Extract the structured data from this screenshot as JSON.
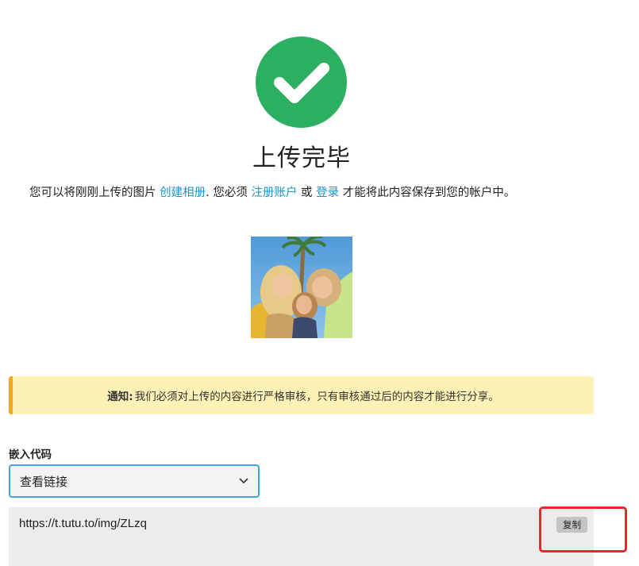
{
  "page": {
    "title": "上传完毕",
    "desc_prefix": "您可以将刚刚上传的图片 ",
    "link_create_album": "创建相册",
    "desc_mid1": ". 您必须 ",
    "link_register": "注册账户",
    "desc_mid2": " 或 ",
    "link_login": "登录",
    "desc_suffix": " 才能将此内容保存到您的帐户中。"
  },
  "notice": {
    "label": "通知:",
    "text": "我们必须对上传的内容进行严格审核，只有审核通过后的内容才能进行分享。"
  },
  "embed": {
    "label": "嵌入代码",
    "selected": "查看链接",
    "code": "https://t.tutu.to/img/ZLzq",
    "copy_label": "复制"
  },
  "icons": {
    "success": "check-circle-icon",
    "dropdown": "chevron-down-icon"
  },
  "colors": {
    "success": "#2bb062",
    "link": "#1b93c9",
    "notice_bg": "#fdf1b5",
    "notice_accent": "#f5a623",
    "select_border": "#3fa7d8",
    "highlight": "#e8262c"
  }
}
